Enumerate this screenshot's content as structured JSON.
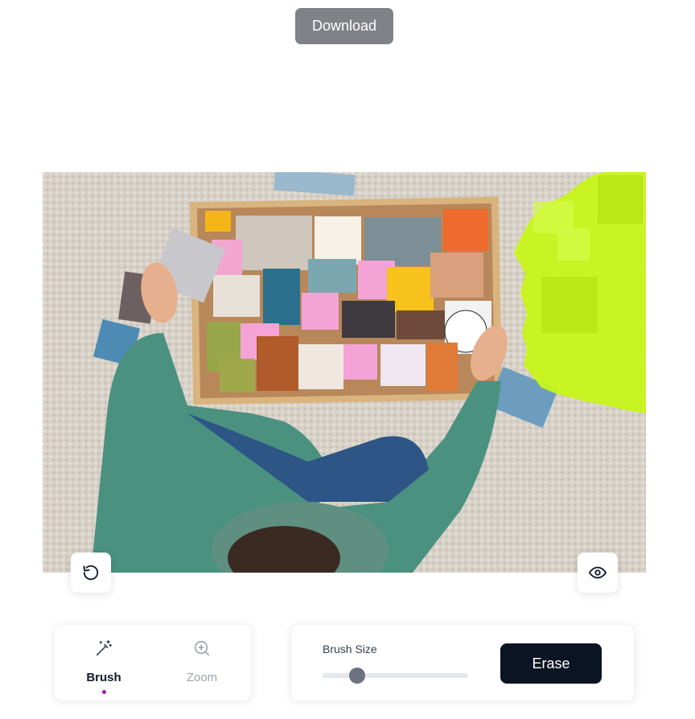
{
  "header": {
    "download_label": "Download"
  },
  "editor": {
    "image_subject": "vision-board-photo",
    "overlay_color": "#c7f51a",
    "reset_icon": "rotate-ccw-icon",
    "preview_icon": "eye-icon"
  },
  "tools": {
    "active": "brush",
    "items": [
      {
        "id": "brush",
        "label": "Brush",
        "icon": "magic-wand-icon"
      },
      {
        "id": "zoom",
        "label": "Zoom",
        "icon": "zoom-in-icon"
      }
    ],
    "active_indicator_color": "#a21caf"
  },
  "brush": {
    "size_label": "Brush Size",
    "size_fraction": 0.24,
    "erase_label": "Erase"
  },
  "colors": {
    "download_bg": "#7f8287",
    "erase_bg": "#0b1422"
  }
}
